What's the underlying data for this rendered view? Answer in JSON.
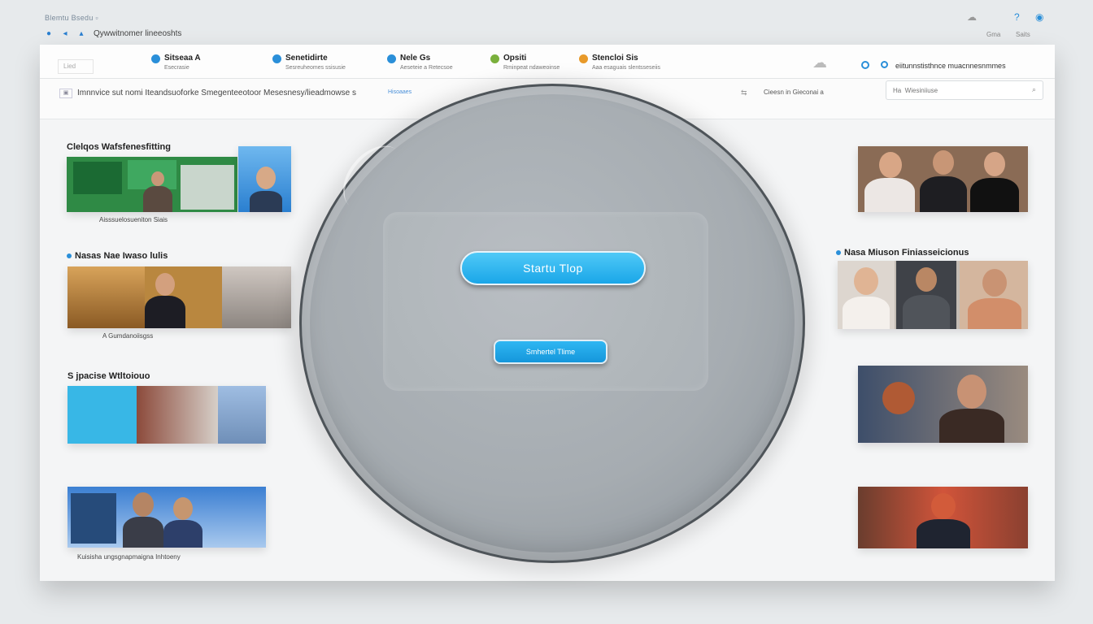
{
  "os": {
    "title_faint": "Blemtu Bsedu  ▫",
    "row_text": "Qywwitnomer lineeoshts",
    "right_labels": [
      "Gma",
      "Saits"
    ]
  },
  "toolbar": {
    "left_label": "Lied",
    "tabs": [
      {
        "title": "Sitseaa A",
        "sub": "Esecrasie",
        "color": "#2a8fd9"
      },
      {
        "title": "Senetidirte",
        "sub": "Sesreuheomes ssisusie",
        "color": "#2a8fd9"
      },
      {
        "title": "Nele Gs",
        "sub": "Aeseteie a Retecsoe",
        "color": "#2a8fd9"
      },
      {
        "title": "Opsiti",
        "sub": "Rminpeat ndaweoinse",
        "color": "#7ab03c"
      },
      {
        "title": "Stencloi  Sis",
        "sub": "Aaa esaguais slentsseseiis",
        "color": "#e89a2a"
      }
    ],
    "right_label": "eiitunnstisthnce  muacnnesnmmes"
  },
  "address": {
    "text": "Imnnvice sut nomi Iteandsuoforke Smegenteeotoor  Mesesnesy/lieadmowse s ",
    "link": "Hisoaaes",
    "mid_text": "Cieesn in Gieconai a",
    "search_placeholder": "Ha  Wiesiniiuse"
  },
  "left_cards": [
    {
      "heading": "Clelqos Wafsfenesfitting",
      "caption": "Aisssuelosueniton Siais"
    },
    {
      "heading": "Nasas  Nae Iwaso lulis",
      "caption": "A Gumdanoiisgss"
    },
    {
      "heading": "S jpacise Wtltoiouo",
      "caption": ""
    },
    {
      "heading": "",
      "caption": "Kuisisha ungsgnapmaigna Inhtoeny"
    }
  ],
  "right_cards": [
    {
      "heading": ""
    },
    {
      "heading": "Nasa  Miuson  Finiasseicionus"
    },
    {
      "heading": ""
    },
    {
      "heading": ""
    }
  ],
  "center": {
    "primary_button": "Startu Tlop",
    "secondary_button": "Smhertel Tlime"
  }
}
